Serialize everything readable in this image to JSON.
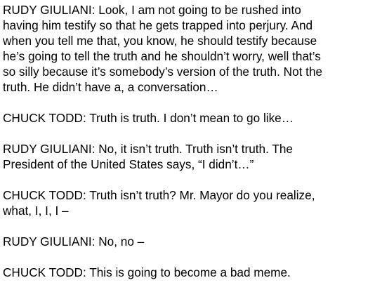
{
  "transcript": {
    "paragraphs": [
      {
        "lines": [
          "RUDY GIULIANI: Look, I am not going to be rushed into",
          "having him testify so that he gets trapped into perjury. And",
          "when you tell me that, you know, he should testify because",
          "he’s going to tell the truth and he shouldn’t worry, well that’s",
          "so silly because it’s somebody’s version of the truth. Not the",
          "truth. He didn’t have a, a conversation…"
        ]
      },
      {
        "lines": [
          "CHUCK TODD: Truth is truth. I don’t mean to go like…"
        ]
      },
      {
        "lines": [
          "RUDY GIULIANI: No, it isn’t truth. Truth isn’t truth. The",
          "President of the United States says, “I didn’t…”"
        ]
      },
      {
        "lines": [
          "CHUCK TODD: Truth isn’t truth? Mr. Mayor do you realize,",
          "what, I, I, I –"
        ]
      },
      {
        "lines": [
          "RUDY GIULIANI: No, no –"
        ]
      },
      {
        "lines": [
          "CHUCK TODD: This is going to become a bad meme."
        ]
      }
    ]
  }
}
